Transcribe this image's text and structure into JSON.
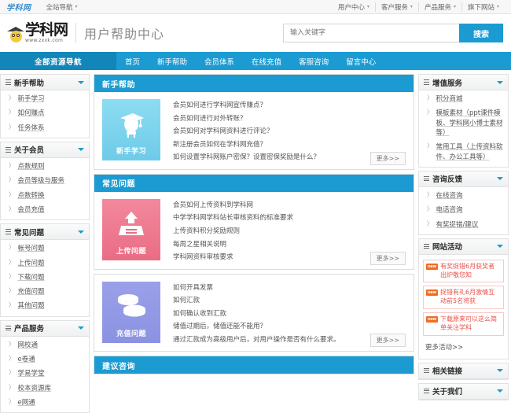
{
  "topbar": {
    "logo": "学科网",
    "left_items": [
      {
        "label": "全站导航",
        "caret": "chevron-down-icon"
      }
    ],
    "right_items": [
      {
        "label": "用户中心"
      },
      {
        "label": "客户服务"
      },
      {
        "label": "产品服务"
      },
      {
        "label": "旗下网站"
      }
    ]
  },
  "header": {
    "brand_name": "学科网",
    "brand_url": "www.zxxk.com",
    "page_title": "用户帮助中心",
    "search_placeholder": "输入关键字",
    "search_value": "",
    "search_button": "搜索"
  },
  "nav": {
    "all_resources": "全部资源导航",
    "items": [
      {
        "label": "首页"
      },
      {
        "label": "新手帮助"
      },
      {
        "label": "会员体系"
      },
      {
        "label": "在线充值"
      },
      {
        "label": "客服咨询"
      },
      {
        "label": "留言中心"
      }
    ]
  },
  "left_sidebar": [
    {
      "title": "新手帮助",
      "links": [
        "新手学习",
        "如何赚点",
        "任务体系"
      ]
    },
    {
      "title": "关于会员",
      "links": [
        "点数规则",
        "会员等级与服务",
        "点数转换",
        "会员充值"
      ]
    },
    {
      "title": "常见问题",
      "links": [
        "帐号问题",
        "上传问题",
        "下载问题",
        "充值问题",
        "其他问题"
      ]
    },
    {
      "title": "产品服务",
      "links": [
        "网校通",
        "e卷通",
        "学易学堂",
        "校本资源库",
        "e网通"
      ]
    }
  ],
  "main_panels": [
    {
      "title": "新手帮助",
      "tile_label": "新手学习",
      "tile_color": "blue",
      "tile_icon": "graduate-mascot-icon",
      "links": [
        "会员如何进行学科网宣传赚点？",
        "会员如何进行对外转账？",
        "会员如何对学科网资料进行评论？",
        "新注册会员如何在学科网充值？",
        "如何设置学科网账户密保？设置密保奖励是什么？"
      ],
      "more": "更多>>"
    },
    {
      "title": "常见问题",
      "tile_label": "上传问题",
      "tile_color": "pink",
      "tile_icon": "upload-tray-icon",
      "links": [
        "会员如何上传资料到学科网",
        "中学学科网学科站长审核资料的标准要求",
        "上传资料积分奖励规则",
        "每周之星相关说明",
        "学科网资料审核要求"
      ],
      "more": "更多>>"
    },
    {
      "title": "",
      "tile_label": "充值问题",
      "tile_color": "purple",
      "tile_icon": "coins-icon",
      "links": [
        "如何开具发票",
        "如何汇款",
        "如何确认收到汇款",
        "储值过期后，储值还能不能用？",
        "通过汇款成为高级用户后，对用户操作是否有什么要求。"
      ],
      "more": "更多>>"
    }
  ],
  "bottom_panel": {
    "title": "建议咨询"
  },
  "right_sidebar": [
    {
      "type": "links",
      "title": "增值服务",
      "links": [
        "积分商城",
        "模板素材（ppt课件模板、学科网小博士素材等）",
        "常用工具（上传资料软件、办公工具等）"
      ]
    },
    {
      "type": "links",
      "title": "咨询反馈",
      "links": [
        "在线咨询",
        "电话咨询",
        "有奖捉错/建议"
      ]
    },
    {
      "type": "activity",
      "title": "网站活动",
      "badge_text": "new",
      "items": [
        "有奖捉错6月获奖者出炉敬您知",
        "捉错有礼6月激情互动前5名将获",
        "下载原来可以这么简单关注学科"
      ],
      "more": "更多活动>>"
    },
    {
      "type": "collapsed",
      "title": "相关链接",
      "links": []
    },
    {
      "type": "collapsed",
      "title": "关于我们",
      "links": []
    }
  ],
  "colors": {
    "primary": "#1b9bd1",
    "primary_dark": "#1286b8",
    "accent_red": "#e8514b",
    "badge_orange": "#f26c21"
  }
}
